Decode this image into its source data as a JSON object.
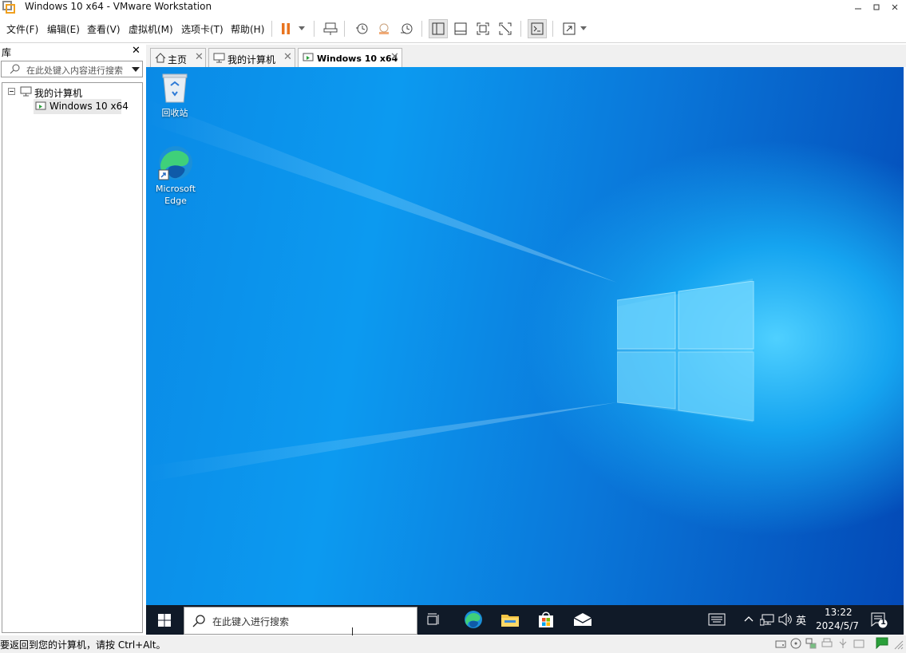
{
  "window": {
    "title": "Windows 10 x64 - VMware Workstation"
  },
  "menu": [
    "文件(F)",
    "编辑(E)",
    "查看(V)",
    "虚拟机(M)",
    "选项卡(T)",
    "帮助(H)"
  ],
  "library": {
    "title": "库",
    "search_placeholder": "在此处键入内容进行搜索",
    "tree": {
      "root": "我的计算机",
      "child": "Windows 10 x64"
    }
  },
  "tabs": [
    {
      "label": "主页",
      "icon": "home-icon"
    },
    {
      "label": "我的计算机",
      "icon": "monitor-icon"
    },
    {
      "label": "Windows 10 x64",
      "icon": "vm-icon",
      "active": true
    }
  ],
  "desktop": {
    "icons": [
      {
        "label": "回收站",
        "icon": "recycle-bin-icon"
      },
      {
        "label_line1": "Microsoft",
        "label_line2": "Edge",
        "icon": "edge-icon"
      }
    ]
  },
  "taskbar": {
    "search_placeholder": "在此键入进行搜索",
    "ime": "英",
    "time": "13:22",
    "date": "2024/5/7",
    "notifications": "1"
  },
  "status": {
    "text": "要返回到您的计算机，请按 Ctrl+Alt。"
  },
  "colors": {
    "accent_orange": "#e8741f",
    "desktop_blue": "#0a8ae6",
    "taskbar": "#101a28"
  }
}
